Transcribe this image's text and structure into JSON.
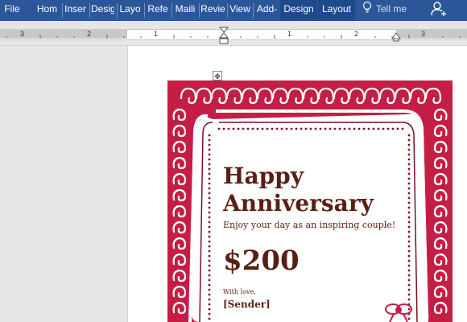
{
  "ribbon": {
    "tabs": [
      {
        "id": "file",
        "label": "File",
        "active": false
      },
      {
        "id": "home",
        "label": "Hom",
        "active": false
      },
      {
        "id": "insert",
        "label": "Inser",
        "active": false
      },
      {
        "id": "design1",
        "label": "Desig",
        "active": false
      },
      {
        "id": "layout1",
        "label": "Layo",
        "active": false
      },
      {
        "id": "references",
        "label": "Refe",
        "active": false
      },
      {
        "id": "mailings",
        "label": "Maili",
        "active": false
      },
      {
        "id": "review",
        "label": "Revie",
        "active": false
      },
      {
        "id": "view",
        "label": "View",
        "active": false
      },
      {
        "id": "addins",
        "label": "Add-",
        "active": false
      },
      {
        "id": "design2",
        "label": "Design",
        "active": true
      },
      {
        "id": "layout2",
        "label": "Layout",
        "active": true
      }
    ],
    "tell_me": "Tell me",
    "colors": {
      "ribbon": "#2b579a",
      "active_tab": "#1e4a8c"
    }
  },
  "ruler": {
    "numbers": [
      "3",
      "2",
      "1",
      "1",
      "2",
      "3"
    ]
  },
  "card": {
    "line1": "Happy",
    "line2": "Anniversary",
    "subtitle": "Enjoy your day as an inspiring couple!",
    "amount": "$200",
    "with_love": "With love,",
    "sender": "[Sender]",
    "colors": {
      "frame": "#c41e45",
      "text": "#5a1f14",
      "dots": "#7a1020"
    }
  }
}
